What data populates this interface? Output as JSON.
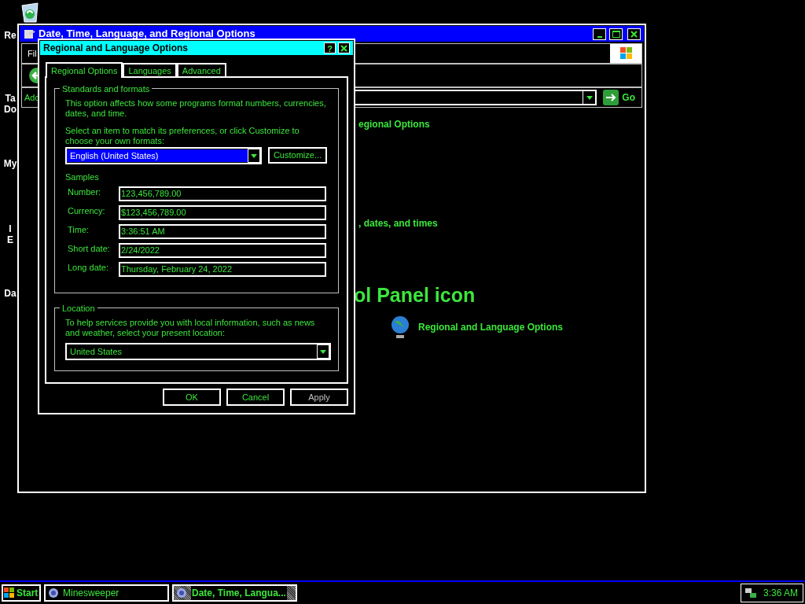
{
  "desktop_icons": [
    {
      "lines": [
        "Re"
      ]
    },
    {
      "lines": [
        "Ta",
        "Do"
      ]
    },
    {
      "lines": [
        "My"
      ]
    },
    {
      "lines": [
        "I",
        "E"
      ]
    },
    {
      "lines": [
        "Da"
      ]
    }
  ],
  "main_window": {
    "title": "Date, Time, Language, and Regional Options",
    "menu_item": "Fil",
    "address_label": "Add",
    "go_label": "Go",
    "content": [
      {
        "kind": "link",
        "text": "egional Options"
      },
      {
        "kind": "link",
        "text": ", dates, and times"
      },
      {
        "kind": "heading",
        "text": "ol Panel icon"
      },
      {
        "kind": "icon_link",
        "text": "Regional and Language Options"
      }
    ]
  },
  "dialog": {
    "title": "Regional and Language Options",
    "help": "?",
    "tabs": [
      {
        "label": "Regional Options",
        "selected": true
      },
      {
        "label": "Languages",
        "selected": false
      },
      {
        "label": "Advanced",
        "selected": false
      }
    ],
    "standards": {
      "legend": "Standards and formats",
      "intro": "This option affects how some programs format numbers, currencies, dates, and time.",
      "prompt": "Select an item to match its preferences, or click Customize to choose your own formats:",
      "format": "English (United States)",
      "customize": "Customize...",
      "samples_label": "Samples",
      "samples": [
        {
          "label": "Number:",
          "value": "123,456,789.00"
        },
        {
          "label": "Currency:",
          "value": "$123,456,789.00"
        },
        {
          "label": "Time:",
          "value": "3:36:51 AM"
        },
        {
          "label": "Short date:",
          "value": "2/24/2022"
        },
        {
          "label": "Long date:",
          "value": "Thursday, February 24, 2022"
        }
      ]
    },
    "location": {
      "legend": "Location",
      "text": "To help services provide you with local information, such as news and weather, select your present location:",
      "value": "United States"
    },
    "buttons": [
      {
        "label": "OK",
        "disabled": false
      },
      {
        "label": "Cancel",
        "disabled": false
      },
      {
        "label": "Apply",
        "disabled": true
      }
    ]
  },
  "taskbar": {
    "start": "Start",
    "tasks": [
      {
        "label": "Minesweeper",
        "selected": false
      },
      {
        "label": "Date, Time, Langua...",
        "selected": true
      }
    ],
    "clock": "3:36 AM"
  }
}
